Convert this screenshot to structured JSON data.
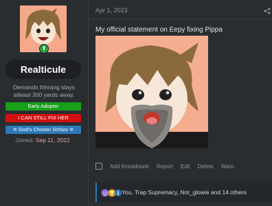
{
  "user": {
    "name": "Realticule",
    "tagline": "Demands thhrang stays atleast 300 yards away.",
    "banners": [
      {
        "label": "Early Adopter",
        "color": "#18a018"
      },
      {
        "label": "I CAN STILL FIX HER",
        "color": "#d30f0f"
      },
      {
        "label": "✡ God's Chosen Schizo ✡",
        "color": "#2d79b7"
      }
    ],
    "joined_label": "Joined:",
    "joined_date": "Sep 11, 2022"
  },
  "post": {
    "date": "Apr 1, 2023",
    "title": "My official statement on Eepy fixing Pippa",
    "actions": [
      "Add threadmark",
      "Report",
      "Edit",
      "Delete",
      "Warn"
    ]
  },
  "reactions": {
    "text": "You, Trap Supremacy, Not_glowie and 14 others",
    "icons": [
      "purple-smile-icon",
      "gold-trophy-icon",
      "blue-info-icon"
    ]
  },
  "colors": {
    "background": "#2a2d30",
    "accent_blue": "#2d79b7",
    "joined_date": "#e9a0a0"
  }
}
